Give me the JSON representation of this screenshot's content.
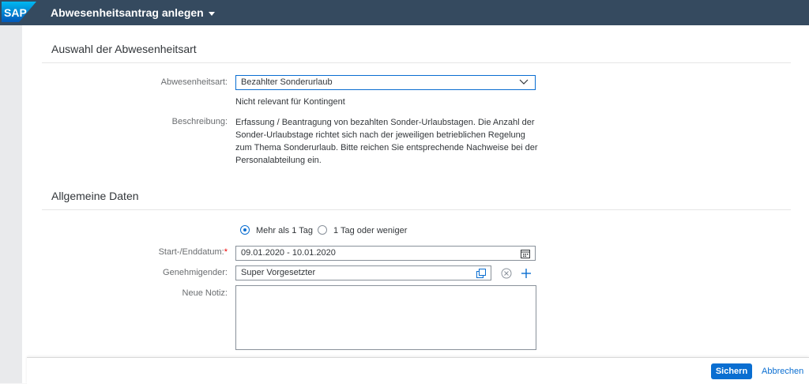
{
  "shell": {
    "logo_text": "SAP",
    "app_title": "Abwesenheitsantrag anlegen"
  },
  "section_absence_type": {
    "title": "Auswahl der Abwesenheitsart",
    "type_label": "Abwesenheitsart:",
    "type_value": "Bezahlter Sonderurlaub",
    "quota_note": "Nicht relevant für Kontingent",
    "description_label": "Beschreibung:",
    "description_lines": [
      "Erfassung / Beantragung von bezahlten Sonder-Urlaubstagen. Die Anzahl der",
      "Sonder-Urlaubstage richtet sich nach der jeweiligen betrieblichen Regelung",
      "zum Thema Sonderurlaub. Bitte reichen Sie entsprechende Nachweise bei der",
      "Personalabteilung ein."
    ]
  },
  "section_general": {
    "title": "Allgemeine Daten",
    "radio_more": "Mehr als 1 Tag",
    "radio_less": "1 Tag oder weniger",
    "date_label": "Start-/Enddatum:",
    "required_mark": "*",
    "date_value": "09.01.2020 - 10.01.2020",
    "approver_label": "Genehmigender:",
    "approver_value": "Super Vorgesetzter",
    "note_label": "Neue Notiz:",
    "note_value": ""
  },
  "footer": {
    "save_label": "Sichern",
    "cancel_label": "Abbrechen"
  },
  "colors": {
    "shell": "#354a5f",
    "accent": "#0a6ed1"
  }
}
